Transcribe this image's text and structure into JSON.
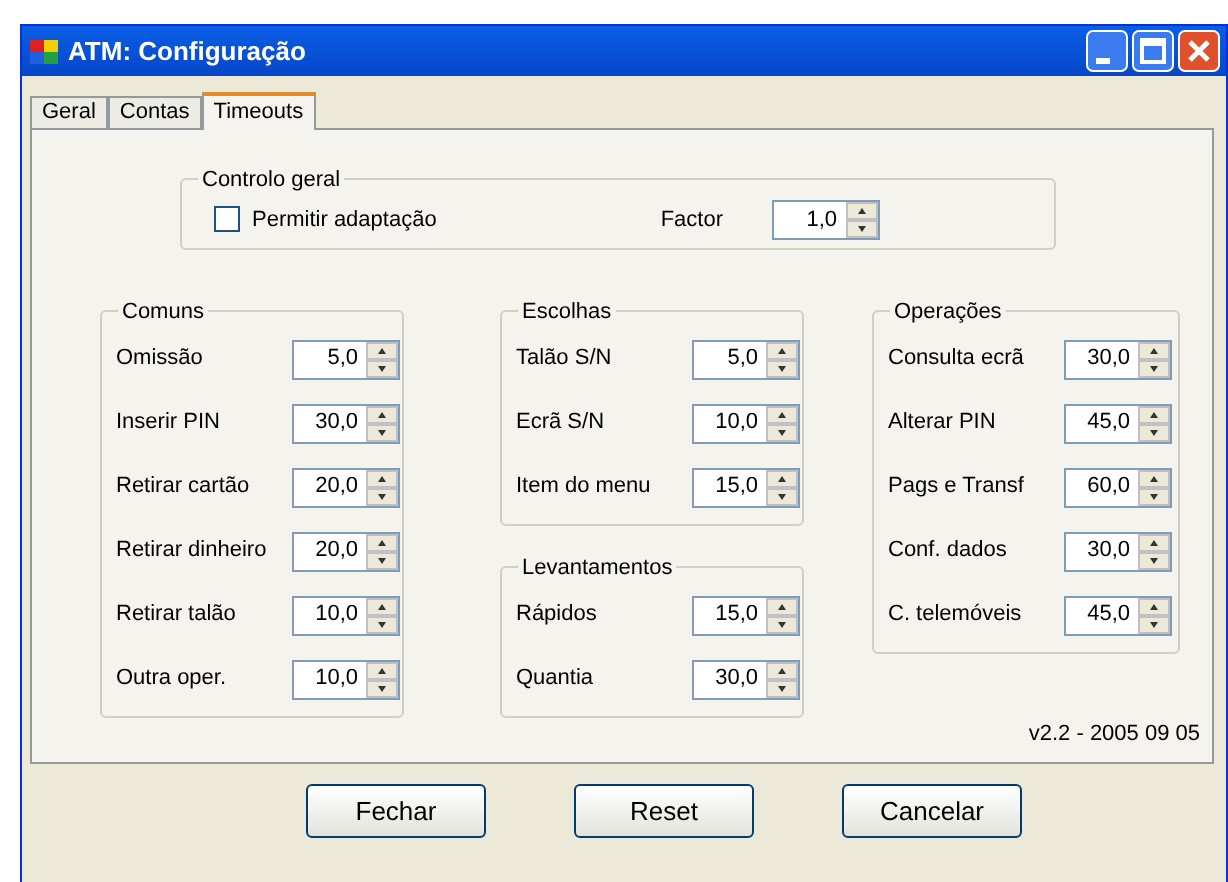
{
  "window": {
    "title": "ATM: Configuração"
  },
  "tabs": [
    {
      "label": "Geral",
      "selected": false
    },
    {
      "label": "Contas",
      "selected": false
    },
    {
      "label": "Timeouts",
      "selected": true
    }
  ],
  "controlo_geral": {
    "title": "Controlo geral",
    "checkbox": {
      "label": "Permitir adaptação",
      "checked": false
    },
    "factor": {
      "label": "Factor",
      "value": "1,0"
    }
  },
  "groups": [
    {
      "title": "Comuns",
      "rows": [
        {
          "label": "Omissão",
          "value": "5,0"
        },
        {
          "label": "Inserir PIN",
          "value": "30,0"
        },
        {
          "label": "Retirar cartão",
          "value": "20,0"
        },
        {
          "label": "Retirar dinheiro",
          "value": "20,0"
        },
        {
          "label": "Retirar talão",
          "value": "10,0"
        },
        {
          "label": "Outra oper.",
          "value": "10,0"
        }
      ]
    },
    {
      "title": "Escolhas",
      "rows": [
        {
          "label": "Talão S/N",
          "value": "5,0"
        },
        {
          "label": "Ecrã S/N",
          "value": "10,0"
        },
        {
          "label": "Item do menu",
          "value": "15,0"
        }
      ]
    },
    {
      "title": "Levantamentos",
      "rows": [
        {
          "label": "Rápidos",
          "value": "15,0"
        },
        {
          "label": "Quantia",
          "value": "30,0"
        }
      ]
    },
    {
      "title": "Operações",
      "rows": [
        {
          "label": "Consulta ecrã",
          "value": "30,0"
        },
        {
          "label": "Alterar PIN",
          "value": "45,0"
        },
        {
          "label": "Pags e Transf",
          "value": "60,0"
        },
        {
          "label": "Conf. dados",
          "value": "30,0"
        },
        {
          "label": "C. telemóveis",
          "value": "45,0"
        }
      ]
    }
  ],
  "version": "v2.2 - 2005 09 05",
  "buttons": [
    "Fechar",
    "Reset",
    "Cancelar"
  ]
}
